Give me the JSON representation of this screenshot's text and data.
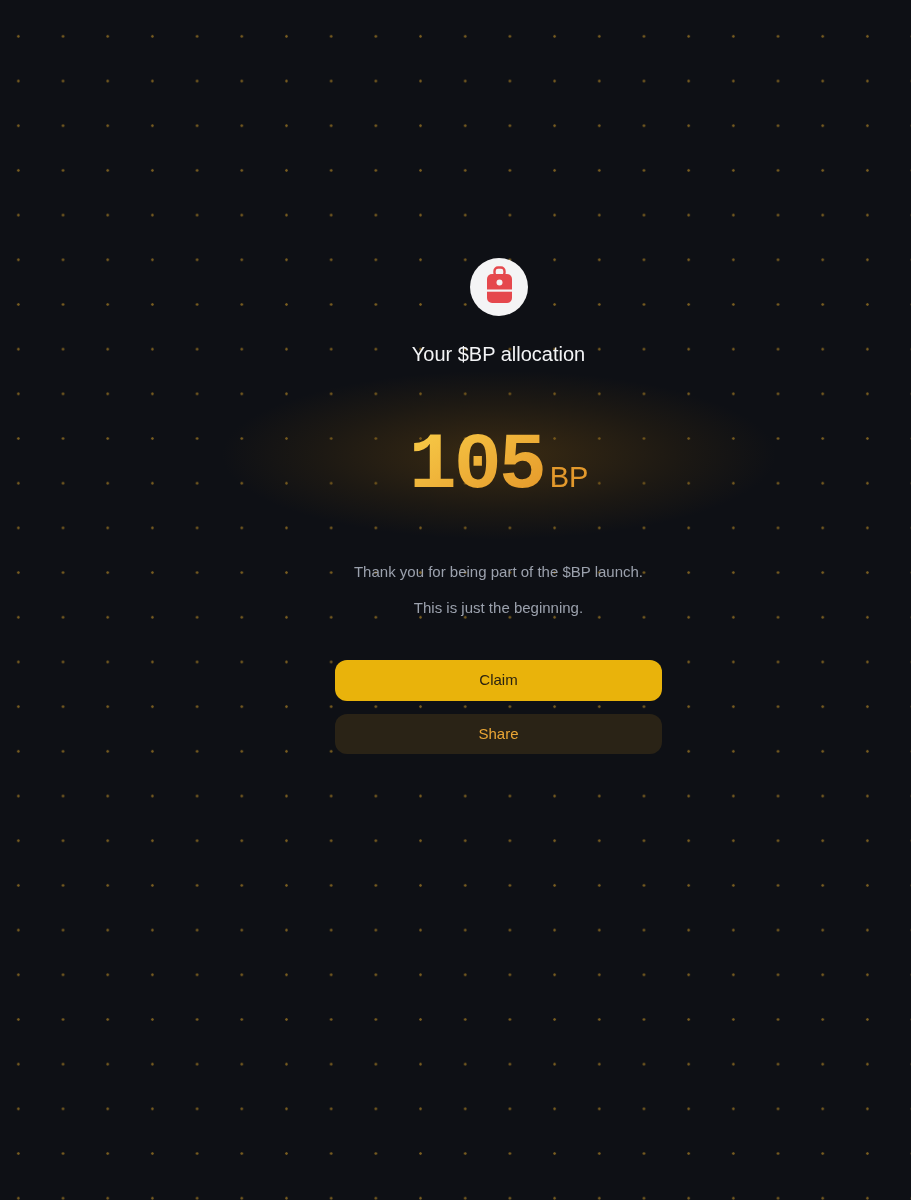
{
  "header": {
    "title": "Your $BP allocation"
  },
  "allocation": {
    "amount": "105",
    "unit": "BP"
  },
  "messages": [
    "Thank you for being part of the $BP launch.",
    "This is just the beginning."
  ],
  "buttons": [
    {
      "label": "Claim",
      "kind": "primary"
    },
    {
      "label": "Share",
      "kind": "secondary"
    }
  ]
}
